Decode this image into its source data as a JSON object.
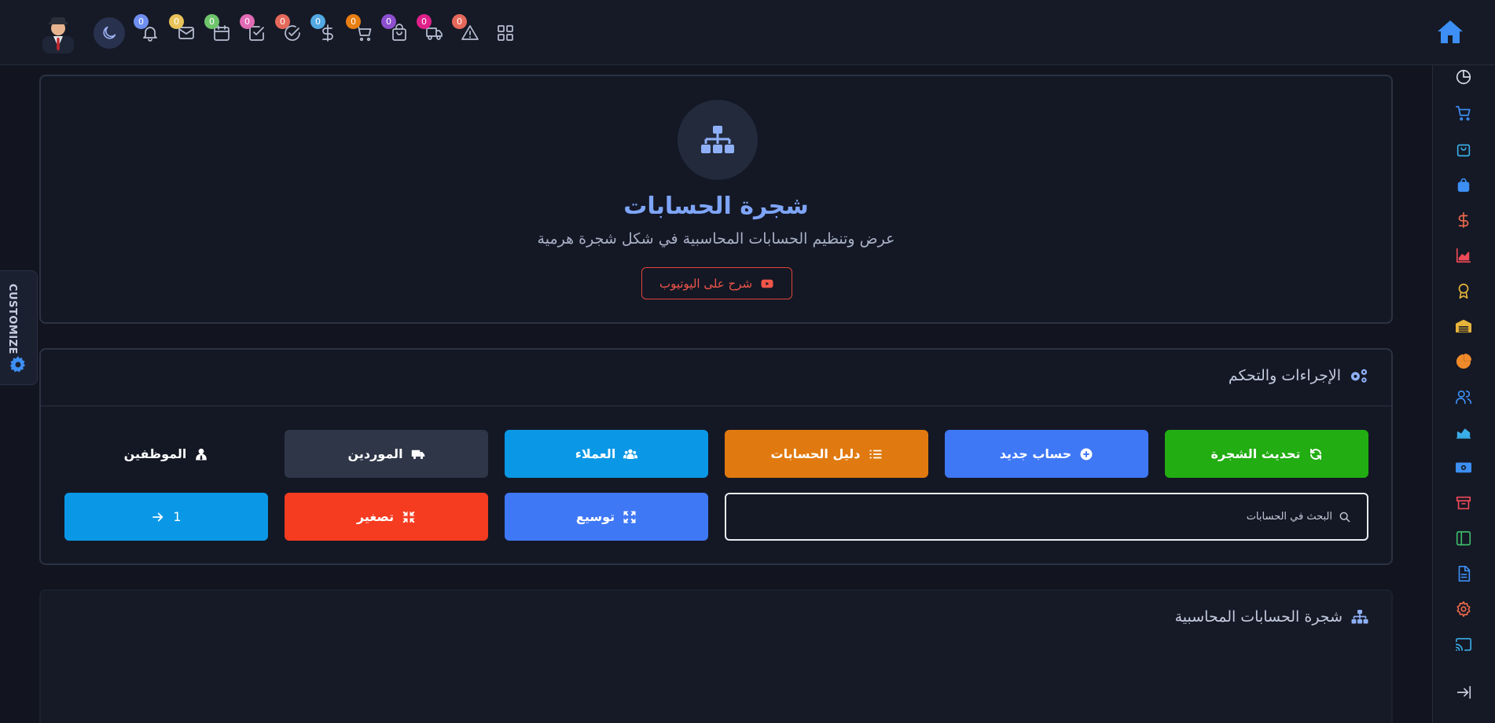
{
  "topbar": {
    "badges": [
      {
        "id": "notifications",
        "icon": "bell-icon",
        "count": "0",
        "color": "#6f8ff0"
      },
      {
        "id": "messages",
        "icon": "mail-icon",
        "count": "0",
        "color": "#e8c35a"
      },
      {
        "id": "calendar",
        "icon": "calendar-icon",
        "count": "0",
        "color": "#6ec56b"
      },
      {
        "id": "tasks",
        "icon": "checkbox-icon",
        "count": "0",
        "color": "#e26bb5"
      },
      {
        "id": "approvals",
        "icon": "check-circle-icon",
        "count": "0",
        "color": "#e5695b"
      },
      {
        "id": "finance",
        "icon": "dollar-icon",
        "count": "0",
        "color": "#52a9e3"
      },
      {
        "id": "cart",
        "icon": "cart-icon",
        "count": "0",
        "color": "#e97e12"
      },
      {
        "id": "purchases",
        "icon": "bag-icon",
        "count": "0",
        "color": "#8d4fd0"
      },
      {
        "id": "shipping",
        "icon": "truck-icon",
        "count": "0",
        "color": "#e0208a"
      },
      {
        "id": "alerts",
        "icon": "alert-icon",
        "count": "0",
        "color": "#e5695b"
      }
    ]
  },
  "customize": {
    "label": "CUSTOMIZE"
  },
  "hero": {
    "title": "شجرة الحسابات",
    "subtitle": "عرض وتنظيم الحسابات المحاسبية في شكل شجرة هرمية",
    "youtube_label": "شرح على اليوتيوب"
  },
  "actions": {
    "title": "الإجراءات والتحكم",
    "buttons": {
      "refresh_tree": "تحديث الشجرة",
      "new_account": "حساب جديد",
      "chart_of_accounts": "دليل الحسابات",
      "customers": "العملاء",
      "suppliers": "الموردين",
      "employees": "الموظفين",
      "expand": "توسيع",
      "collapse": "تصغير",
      "level_value": "1"
    },
    "search_placeholder": "البحث في الحسابات"
  },
  "tree": {
    "title": "شجرة الحسابات المحاسبية"
  },
  "colors": {
    "green": "#22ad12",
    "blue": "#3f78f5",
    "orange": "#e07a10",
    "sky": "#0a98e6",
    "slate": "#2e3648",
    "red": "#f53b20",
    "accent": "#7ea5f8"
  }
}
